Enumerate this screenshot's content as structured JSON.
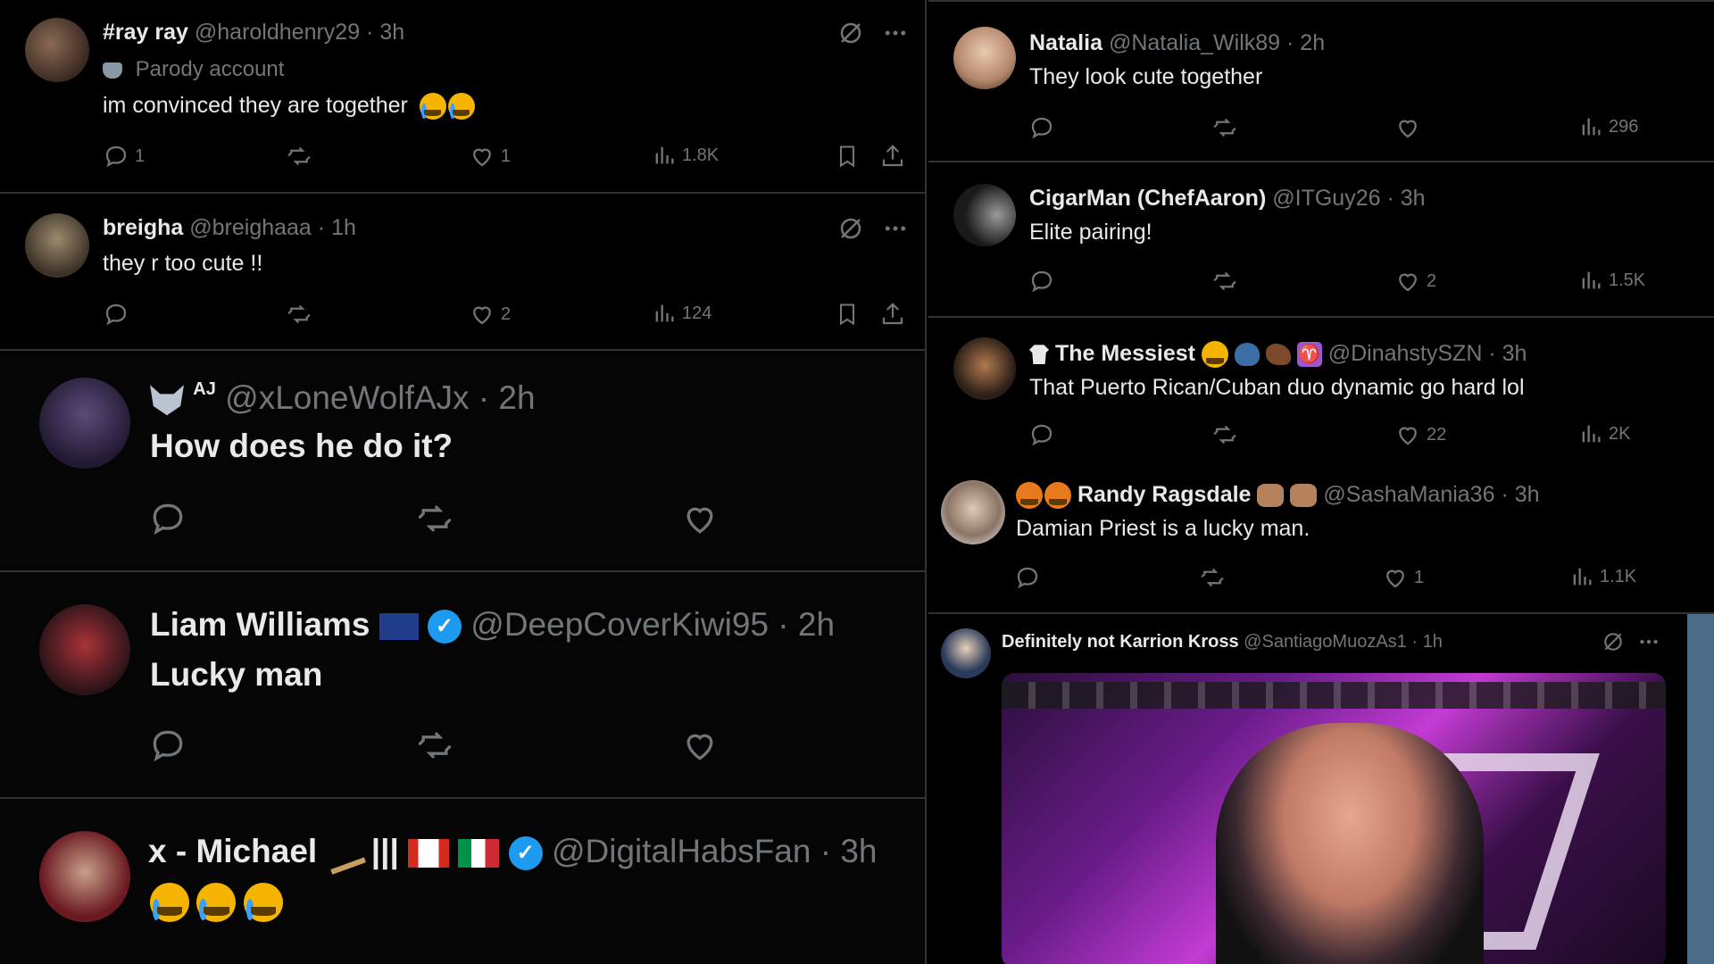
{
  "left_panel": {
    "tweets": [
      {
        "name": "#ray ray",
        "handle": "@haroldhenry29",
        "time": "· 3h",
        "badge": "Parody account",
        "text": "im convinced they are together",
        "replies": "1",
        "likes": "1",
        "views": "1.8K"
      },
      {
        "name": "breigha",
        "handle": "@breighaaa",
        "time": "· 1h",
        "text": "they r too cute !!",
        "replies": "",
        "likes": "2",
        "views": "124"
      },
      {
        "name": "AJ",
        "handle": "@xLoneWolfAJx",
        "time": "· 2h",
        "text": "How does he do it?"
      },
      {
        "name": "Liam Williams",
        "handle": "@DeepCoverKiwi95",
        "time": "· 2h",
        "text": "Lucky man"
      },
      {
        "name": "x - Michael",
        "name_suffix": "|||",
        "handle": "@DigitalHabsFan",
        "time": "· 3h"
      }
    ]
  },
  "right_panel": {
    "tweets": [
      {
        "name": "Natalia",
        "handle": "@Natalia_Wilk89",
        "time": "· 2h",
        "text": "They look cute together",
        "likes": "",
        "views": "296"
      },
      {
        "name": "CigarMan (ChefAaron)",
        "handle": "@ITGuy26",
        "time": "· 3h",
        "text": "Elite pairing!",
        "likes": "2",
        "views": "1.5K"
      },
      {
        "name": "The Messiest",
        "handle": "@DinahstySZN",
        "time": "· 3h",
        "text": "That Puerto Rican/Cuban duo dynamic go hard lol",
        "likes": "22",
        "views": "2K"
      },
      {
        "name": "Randy Ragsdale",
        "handle": "@SashaMania36",
        "time": "· 3h",
        "text": "Damian Priest is a lucky man.",
        "likes": "1",
        "views": "1.1K"
      },
      {
        "name": "Definitely not Karrion Kross",
        "handle": "@SantiagoMuozAs1",
        "time": "· 1h"
      }
    ]
  },
  "colors": {
    "background": "#000000",
    "text": "#e7e9ea",
    "muted": "#71767b",
    "border": "#2f3336",
    "verified": "#1d9bf0"
  }
}
